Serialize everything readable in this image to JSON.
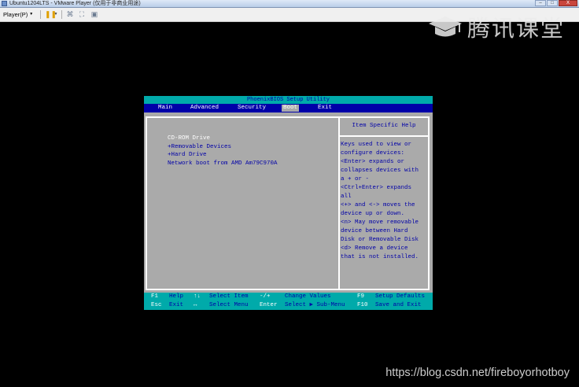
{
  "window": {
    "title": "Ubuntu1204LTS - VMware Player (仅用于非商业用途)",
    "controls": [
      "–",
      "□",
      "X"
    ]
  },
  "toolbar": {
    "player_menu_label": "Player(P)",
    "icons": [
      "pause-icon",
      "send-ctrl-alt-del-icon",
      "fullscreen-icon",
      "unity-icon"
    ]
  },
  "watermark": {
    "brand": "腾讯课堂",
    "url": "https://blog.csdn.net/fireboyorhotboy"
  },
  "bios": {
    "title": "PhoenixBIOS Setup Utility",
    "menu": [
      {
        "label": "Main",
        "active": false
      },
      {
        "label": "Advanced",
        "active": false
      },
      {
        "label": "Security",
        "active": false
      },
      {
        "label": "Boot",
        "active": true
      },
      {
        "label": "Exit",
        "active": false
      }
    ],
    "boot_items": [
      {
        "label": "CD-ROM Drive",
        "selected": true
      },
      {
        "label": "+Removable Devices",
        "selected": false
      },
      {
        "label": "+Hard Drive",
        "selected": false
      },
      {
        "label": "Network boot from AMD Am79C970A",
        "selected": false
      }
    ],
    "help_title": "Item Specific Help",
    "help_lines": [
      "Keys used to view or",
      "configure devices:",
      "<Enter> expands or",
      "collapses devices with",
      "a + or -",
      "<Ctrl+Enter> expands",
      "all",
      "<+> and <-> moves the",
      "device up or down.",
      "<n> May move removable",
      "device between Hard",
      "Disk or Removable Disk",
      "<d> Remove a device",
      "that is not installed."
    ],
    "footer": {
      "row1": [
        {
          "key": "F1",
          "action": "Help"
        },
        {
          "key": "↑↓",
          "action": "Select Item"
        },
        {
          "key": "-/+",
          "action": "Change Values"
        },
        {
          "key": "F9",
          "action": "Setup Defaults"
        }
      ],
      "row2": [
        {
          "key": "Esc",
          "action": "Exit"
        },
        {
          "key": "↔",
          "action": "Select Menu"
        },
        {
          "key": "Enter",
          "action": "Select ▶ Sub-Menu"
        },
        {
          "key": "F10",
          "action": "Save and Exit"
        }
      ]
    },
    "colors": {
      "cyan": "#00aaaa",
      "blue": "#0000a8",
      "gray": "#aaaaaa",
      "white": "#ffffff"
    }
  }
}
